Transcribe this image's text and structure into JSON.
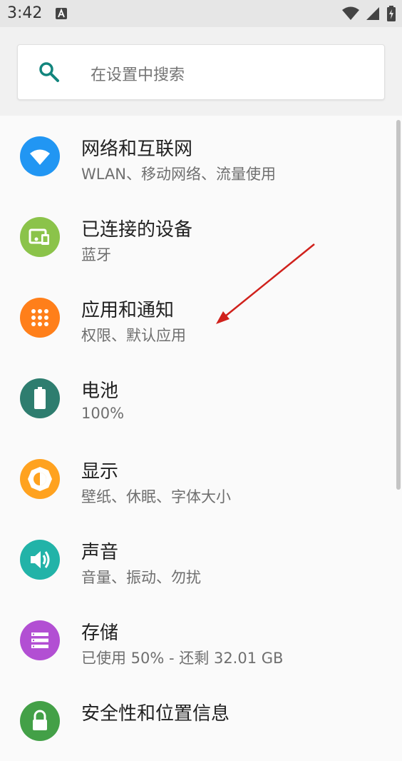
{
  "status_bar": {
    "time": "3:42"
  },
  "search": {
    "placeholder": "在设置中搜索"
  },
  "items": [
    {
      "title": "网络和互联网",
      "subtitle": "WLAN、移动网络、流量使用",
      "icon": "wifi-icon",
      "color": "#2196f3"
    },
    {
      "title": "已连接的设备",
      "subtitle": "蓝牙",
      "icon": "devices-icon",
      "color": "#8bc34a"
    },
    {
      "title": "应用和通知",
      "subtitle": "权限、默认应用",
      "icon": "apps-icon",
      "color": "#ff7f1a"
    },
    {
      "title": "电池",
      "subtitle": "100%",
      "icon": "battery-icon",
      "color": "#2e7d6f"
    },
    {
      "title": "显示",
      "subtitle": "壁纸、休眠、字体大小",
      "icon": "brightness-icon",
      "color": "#ffa21f"
    },
    {
      "title": "声音",
      "subtitle": "音量、振动、勿扰",
      "icon": "volume-icon",
      "color": "#22b3a8"
    },
    {
      "title": "存储",
      "subtitle": "已使用 50% - 还剩 32.01 GB",
      "icon": "storage-icon",
      "color": "#b24fd3"
    },
    {
      "title": "安全性和位置信息",
      "subtitle": "",
      "icon": "lock-icon",
      "color": "#43a047"
    }
  ],
  "annotation": {
    "color": "#d0211c"
  }
}
